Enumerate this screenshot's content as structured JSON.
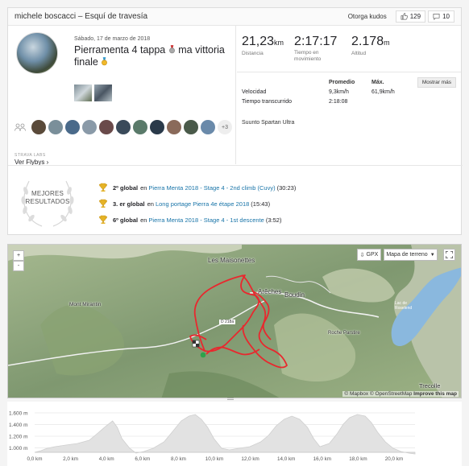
{
  "header": {
    "title": "michele boscacci – Esquí de travesía",
    "kudos_label": "Otorga kudos",
    "kudos_count": "129",
    "comments_count": "10"
  },
  "activity": {
    "date": "Sábado, 17 de marzo de 2018",
    "title_part1": "Pierramenta 4 tappa",
    "title_part2": "ma vittoria finale",
    "flyby_heading": "STRAVA LABS",
    "flyby_label": "Ver Flybys",
    "more_athletes": "+3"
  },
  "stats": [
    {
      "value": "21,23",
      "unit": "km",
      "label": "Distancia"
    },
    {
      "value": "2:17:17",
      "unit": "",
      "label": "Tiempo en movimiento"
    },
    {
      "value": "2.178",
      "unit": "m",
      "label": "Altitud"
    }
  ],
  "metrics": {
    "col_avg": "Promedio",
    "col_max": "Máx.",
    "more_button": "Mostrar más",
    "rows": [
      {
        "name": "Velocidad",
        "avg": "9,3km/h",
        "max": "61,9km/h"
      },
      {
        "name": "Tiempo transcurrido",
        "avg": "2:18:08",
        "max": ""
      }
    ],
    "device": "Suunto Spartan Ultra"
  },
  "best": {
    "badge_line1": "MEJORES",
    "badge_line2": "RESULTADOS",
    "achievements": [
      {
        "rank": "2º global",
        "connector": "en",
        "segment": "Pierra Menta 2018 - Stage 4 - 2nd climb (Cuvy)",
        "time": "(30:23)"
      },
      {
        "rank": "3. er global",
        "connector": "en",
        "segment": "Long portage Pierra 4e étape 2018",
        "time": "(15:43)"
      },
      {
        "rank": "6º global",
        "connector": "en",
        "segment": "Pierra Menta 2018 - Stage 4 - 1st descente",
        "time": "(3:52)"
      }
    ],
    "trophy_color": "#e6b325"
  },
  "map": {
    "zoom_in": "+",
    "zoom_out": "-",
    "gpx_label": "GPX",
    "terrain_label": "Mapa de terreno",
    "places": {
      "maisonettes": "Les Maisonettes",
      "arches": "Arêches",
      "boudin": "Boudin",
      "mirantin": "Mont Mirantin",
      "parstire": "Roche Parstire",
      "lac": "Lac de Roselend",
      "road": "D 218a",
      "trecolle": "Trecolle"
    },
    "attribution_prefix": "© Mapbox © OpenStreetMap",
    "attribution_link": "Improve this map",
    "route_color": "#e8282e"
  },
  "elevation": {
    "y_ticks": [
      "1.600 m",
      "1.400 m",
      "1.200 m",
      "1.000 m"
    ],
    "x_ticks": [
      "0,0 km",
      "2,0 km",
      "4,0 km",
      "6,0 km",
      "8,0 km",
      "10,0 km",
      "12,0 km",
      "14,0 km",
      "16,0 km",
      "18,0 km",
      "20,0 km"
    ]
  }
}
